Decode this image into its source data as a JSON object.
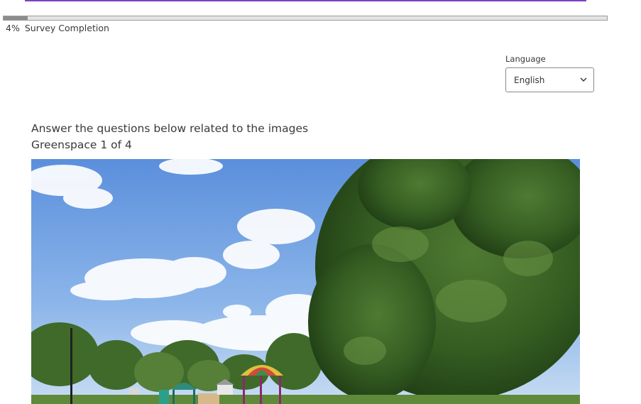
{
  "progress": {
    "percent_label": "4%",
    "label": "Survey Completion",
    "fraction": 0.04
  },
  "language": {
    "label": "Language",
    "selected": "English",
    "icon": "chevron-down-icon"
  },
  "question": {
    "instruction": "Answer the questions below related to the images",
    "subtitle": "Greenspace 1 of 4"
  },
  "image": {
    "subject": "park-greenspace-photo"
  },
  "colors": {
    "accent": "#7e3fc6",
    "progress_fill": "#8c8c8c",
    "progress_track": "#e4e4e4"
  }
}
